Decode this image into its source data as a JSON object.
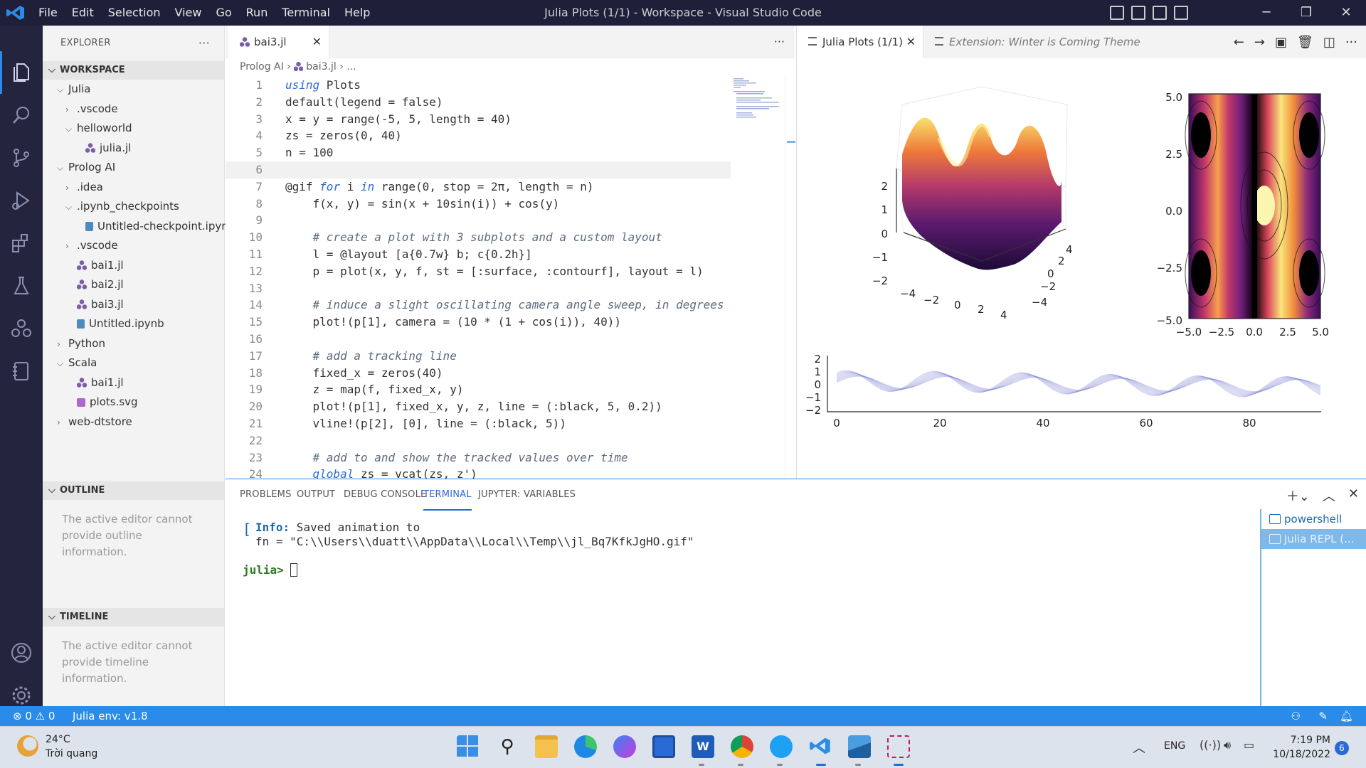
{
  "window": {
    "title": "Julia Plots (1/1) - Workspace - Visual Studio Code"
  },
  "menu": [
    "File",
    "Edit",
    "Selection",
    "View",
    "Go",
    "Run",
    "Terminal",
    "Help"
  ],
  "sidebar": {
    "header": "EXPLORER",
    "dots": "···",
    "workspace_label": "WORKSPACE",
    "tree": [
      {
        "label": "Julia",
        "depth": 1,
        "type": "folder-open"
      },
      {
        "label": ".vscode",
        "depth": 2,
        "type": "folder"
      },
      {
        "label": "helloworld",
        "depth": 2,
        "type": "folder-open"
      },
      {
        "label": "julia.jl",
        "depth": 3,
        "type": "julia"
      },
      {
        "label": "Prolog AI",
        "depth": 1,
        "type": "folder-open"
      },
      {
        "label": ".idea",
        "depth": 2,
        "type": "folder"
      },
      {
        "label": ".ipynb_checkpoints",
        "depth": 2,
        "type": "folder-open"
      },
      {
        "label": "Untitled-checkpoint.ipynb",
        "depth": 3,
        "type": "notebook"
      },
      {
        "label": ".vscode",
        "depth": 2,
        "type": "folder"
      },
      {
        "label": "bai1.jl",
        "depth": 2,
        "type": "julia"
      },
      {
        "label": "bai2.jl",
        "depth": 2,
        "type": "julia"
      },
      {
        "label": "bai3.jl",
        "depth": 2,
        "type": "julia"
      },
      {
        "label": "Untitled.ipynb",
        "depth": 2,
        "type": "notebook"
      },
      {
        "label": "Python",
        "depth": 1,
        "type": "folder"
      },
      {
        "label": "Scala",
        "depth": 1,
        "type": "folder-open"
      },
      {
        "label": "bai1.jl",
        "depth": 2,
        "type": "julia"
      },
      {
        "label": "plots.svg",
        "depth": 2,
        "type": "svg"
      },
      {
        "label": "web-dtstore",
        "depth": 1,
        "type": "folder"
      }
    ],
    "outline": {
      "label": "OUTLINE",
      "message": "The active editor cannot provide outline information."
    },
    "timeline": {
      "label": "TIMELINE",
      "message": "The active editor cannot provide timeline information."
    }
  },
  "editor": {
    "tab_label": "bai3.jl",
    "more": "···",
    "breadcrumb": [
      "Prolog AI",
      "bai3.jl",
      "..."
    ],
    "lines": [
      "using Plots",
      "default(legend = false)",
      "x = y = range(-5, 5, length = 40)",
      "zs = zeros(0, 40)",
      "n = 100",
      "",
      "@gif for i in range(0, stop = 2π, length = n)",
      "    f(x, y) = sin(x + 10sin(i)) + cos(y)",
      "",
      "    # create a plot with 3 subplots and a custom layout",
      "    l = @layout [a{0.7w} b; c{0.2h}]",
      "    p = plot(x, y, f, st = [:surface, :contourf], layout = l)",
      "",
      "    # induce a slight oscillating camera angle sweep, in degrees",
      "    plot!(p[1], camera = (10 * (1 + cos(i)), 40))",
      "",
      "    # add a tracking line",
      "    fixed_x = zeros(40)",
      "    z = map(f, fixed_x, y)",
      "    plot!(p[1], fixed_x, y, z, line = (:black, 5, 0.2))",
      "    vline!(p[2], [0], line = (:black, 5))",
      "",
      "    # add to and show the tracked values over time",
      "    global zs = vcat(zs, z')"
    ],
    "line_numbers": [
      "1",
      "2",
      "3",
      "4",
      "5",
      "6",
      "7",
      "8",
      "9",
      "10",
      "11",
      "12",
      "13",
      "14",
      "15",
      "16",
      "17",
      "18",
      "19",
      "20",
      "21",
      "22",
      "23",
      "24"
    ]
  },
  "plot_pane": {
    "tab_active": "Julia Plots (1/1)",
    "tab_other": "Extension: Winter is Coming Theme",
    "surface_z_ticks": [
      "2",
      "1",
      "0",
      "−1",
      "−2"
    ],
    "surface_x_ticks": [
      "−4",
      "−2",
      "0",
      "2",
      "4"
    ],
    "surface_y_ticks": [
      "4",
      "2",
      "0",
      "−2",
      "−4"
    ],
    "contour_y_ticks": [
      "5.0",
      "2.5",
      "0.0",
      "−2.5",
      "−5.0"
    ],
    "contour_x_ticks": [
      "−5.0",
      "−2.5",
      "0.0",
      "2.5",
      "5.0"
    ],
    "line_y_ticks": [
      "2",
      "1",
      "0",
      "−1",
      "−2"
    ],
    "line_x_ticks": [
      "0",
      "20",
      "40",
      "60",
      "80"
    ]
  },
  "panel": {
    "tabs": [
      "PROBLEMS",
      "OUTPUT",
      "DEBUG CONSOLE",
      "TERMINAL",
      "JUPYTER: VARIABLES"
    ],
    "active_tab": "TERMINAL",
    "terminal": {
      "info_label": "Info:",
      "info_text": " Saved animation to",
      "path_line": "  fn = \"C:\\\\Users\\\\duatt\\\\AppData\\\\Local\\\\Temp\\\\jl_Bq7KfkJgHO.gif\"",
      "prompt": "julia>"
    },
    "terminals": [
      "powershell",
      "Julia REPL (..."
    ]
  },
  "status": {
    "problems": "⊗ 0 ⚠ 0",
    "env": "Julia env: v1.8"
  },
  "taskbar": {
    "weather_temp": "24°C",
    "weather_desc": "Trời quang",
    "lang": "ENG",
    "time": "7:19 PM",
    "date": "10/18/2022",
    "notif": "6"
  },
  "colors": {
    "accent": "#2a8be8",
    "titlebar": "#1f1f3a",
    "activitybar": "#24243e"
  }
}
